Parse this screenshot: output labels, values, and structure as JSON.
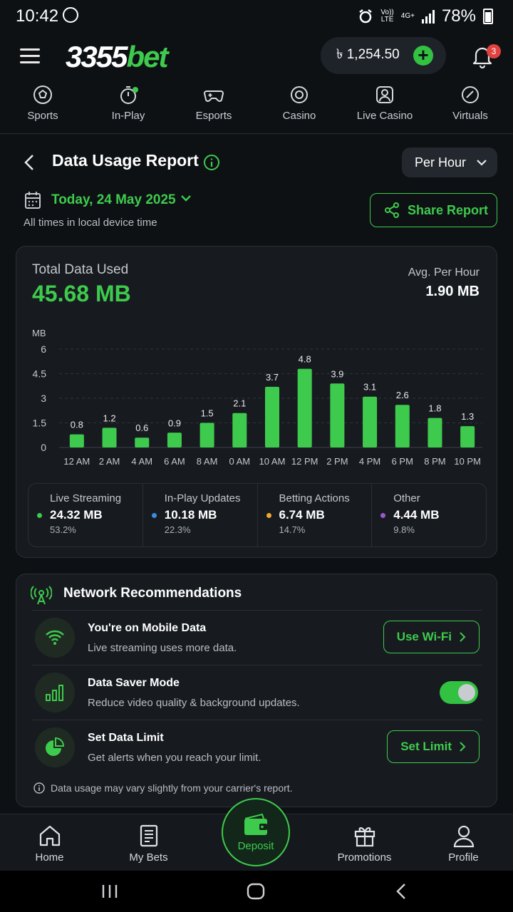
{
  "status": {
    "time": "10:42",
    "net_top": "Vo))",
    "net_bottom": "LTE",
    "gen": "4G+",
    "battery": "78%"
  },
  "header": {
    "logo_num": "3355",
    "logo_bet": "bet",
    "balance": "৳ 1,254.50",
    "plus": "+",
    "notif_count": "3"
  },
  "nav": [
    {
      "label": "Sports",
      "icon": "soccer-ball-icon"
    },
    {
      "label": "In-Play",
      "icon": "stopwatch-icon"
    },
    {
      "label": "Esports",
      "icon": "gamepad-icon"
    },
    {
      "label": "Casino",
      "icon": "casino-chip-icon"
    },
    {
      "label": "Live Casino",
      "icon": "dealer-icon"
    },
    {
      "label": "Virtuals",
      "icon": "gauge-icon"
    }
  ],
  "page": {
    "title": "Data Usage Report",
    "period": "Per Hour",
    "date": "Today, 24 May 2025",
    "local_note": "All times in local device time",
    "share": "Share Report"
  },
  "summary": {
    "total_label": "Total Data Used",
    "total_value": "45.68 MB",
    "avg_label": "Avg. Per Hour",
    "avg_value": "1.90 MB"
  },
  "chart_data": {
    "type": "bar",
    "ylabel": "MB",
    "ylim": [
      0,
      6
    ],
    "yticks": [
      "0",
      "1.5",
      "3",
      "4.5",
      "6"
    ],
    "ytick_values": [
      0,
      1.5,
      3,
      4.5,
      6
    ],
    "categories": [
      "12 AM",
      "2 AM",
      "4 AM",
      "6 AM",
      "8 AM",
      "0 AM",
      "10 AM",
      "12 PM",
      "2 PM",
      "4 PM",
      "6 PM",
      "8 PM",
      "10 PM"
    ],
    "values": [
      0.8,
      1.2,
      0.6,
      0.9,
      1.5,
      2.1,
      3.7,
      4.8,
      3.9,
      3.1,
      2.6,
      1.8,
      1.3
    ],
    "labels": [
      "0.8",
      "1.2",
      "0.6",
      "0.9",
      "1.5",
      "2.1",
      "3.7",
      "4.8",
      "3.9",
      "3.1",
      "2.6",
      "1.8",
      "1.3"
    ],
    "grid": true,
    "color": "#3ecb4d"
  },
  "legend": [
    {
      "name": "Live Streaming",
      "value": "24.32 MB",
      "pct": "53.2%",
      "color": "#3ecb4d"
    },
    {
      "name": "In-Play Updates",
      "value": "10.18 MB",
      "pct": "22.3%",
      "color": "#3b8de0"
    },
    {
      "name": "Betting Actions",
      "value": "6.74 MB",
      "pct": "14.7%",
      "color": "#f0a92e"
    },
    {
      "name": "Other",
      "value": "4.44 MB",
      "pct": "9.8%",
      "color": "#9b59d0"
    }
  ],
  "network": {
    "title": "Network Recommendations",
    "rows": [
      {
        "title": "You're on Mobile Data",
        "sub": "Live streaming uses more data.",
        "button": "Use Wi-Fi"
      },
      {
        "title": "Data Saver Mode",
        "sub": "Reduce video quality & background updates.",
        "toggle_on": true
      },
      {
        "title": "Set Data Limit",
        "sub": "Get alerts when you reach your limit.",
        "button": "Set Limit"
      }
    ],
    "footnote": "Data usage may vary slightly from your carrier's report."
  },
  "bottom_nav": {
    "home": "Home",
    "bets": "My Bets",
    "deposit": "Deposit",
    "promos": "Promotions",
    "profile": "Profile"
  }
}
